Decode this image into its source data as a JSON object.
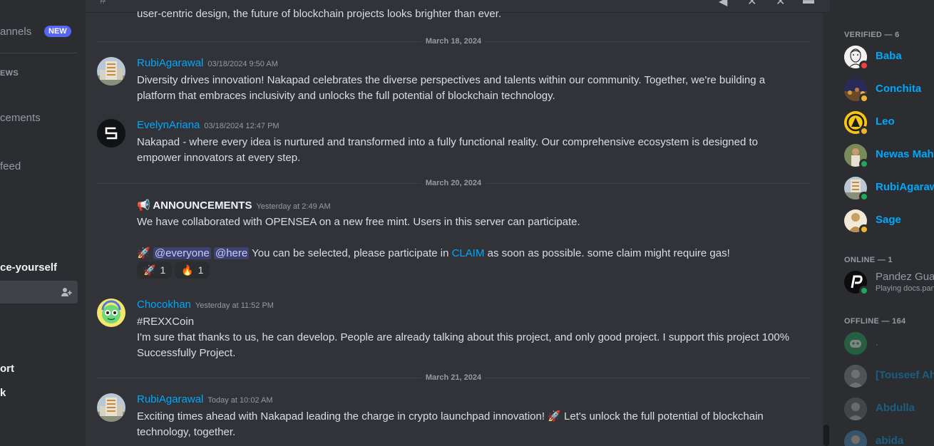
{
  "sidebar": {
    "channels_label": "annels",
    "new_badge": "NEW",
    "news_category": "EWS",
    "announcements": "cements",
    "feed": "feed",
    "introduce": "ce-yourself",
    "support": "ort",
    "k_item": "k"
  },
  "chat": {
    "top_line": "user-centric design, the future of blockchain projects looks brighter than ever.",
    "dividers": [
      "March 18, 2024",
      "March 20, 2024",
      "March 21, 2024"
    ],
    "messages": [
      {
        "author": "RubiAgarawal",
        "timestamp": "03/18/2024 9:50 AM",
        "body": "Diversity drives innovation! Nakapad celebrates the diverse perspectives and talents within our community. Together, we're building a platform that embraces inclusivity and unlocks the full potential of blockchain technology."
      },
      {
        "author": "EvelynAriana",
        "timestamp": "03/18/2024 12:47 PM",
        "body": "Nakapad - where every idea is nurtured and transformed into a fully functional reality. Our comprehensive ecosystem is designed to empower innovators at every step."
      },
      {
        "author": "📢 ANNOUNCEMENTS",
        "timestamp": "Yesterday at 2:49 AM",
        "body_line1": "We have collaborated with OPENSEA on a new free mint. Users in this server can participate.",
        "rocket": "🚀",
        "mention_everyone": "@everyone",
        "mention_here": "@here",
        "body_mid": " You can be selected, please participate in ",
        "link": "CLAIM",
        "body_end": " as soon as possible. some claim might require gas!",
        "reactions": [
          {
            "emoji": "🚀",
            "count": "1"
          },
          {
            "emoji": "🔥",
            "count": "1"
          }
        ]
      },
      {
        "author": "Chocokhan",
        "timestamp": "Yesterday at 11:52 PM",
        "line1": "#REXXCoin",
        "line2": "I'm sure that thanks to us, he can develop. People are already talking about this project, and only good project. I support this project 100% Successfully Project."
      },
      {
        "author": "RubiAgarawal",
        "timestamp": "Today at 10:02 AM",
        "body_a": "Exciting times ahead with Nakapad leading the charge in crypto launchpad innovation! ",
        "rocket": "🚀",
        "body_b": " Let's unlock the full potential of blockchain technology, together."
      }
    ]
  },
  "members": {
    "verified_header": "VERIFIED — 6",
    "verified": [
      "Baba",
      "Conchita",
      "Leo",
      "Newas Mahmud",
      "RubiAgarawal",
      "Sage"
    ],
    "online_header": "ONLINE — 1",
    "online": [
      {
        "name": "Pandez Guardian",
        "activity": "Playing docs.pandez"
      }
    ],
    "offline_header": "OFFLINE — 164",
    "offline": [
      ".",
      "[Touseef Ahmed]",
      "Abdulla",
      "abida"
    ]
  },
  "colors": {
    "accent": "#00a8fc",
    "online": "#23a55a",
    "idle": "#f0b232",
    "dnd": "#f23f43",
    "brand": "#5865f2"
  }
}
